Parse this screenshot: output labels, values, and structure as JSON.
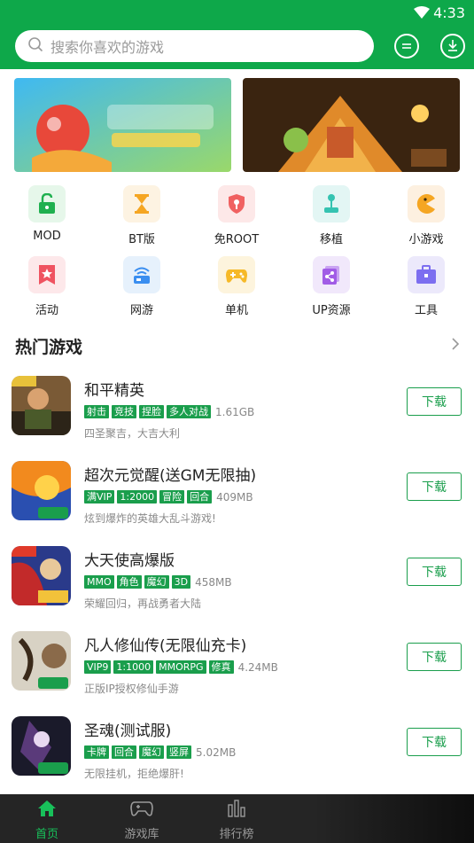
{
  "status": {
    "time": "4:33"
  },
  "search": {
    "placeholder": "搜索你喜欢的游戏"
  },
  "banners": [
    {
      "name": "banner-bouncing-ball-game"
    },
    {
      "name": "banner-sandbox-world-game"
    }
  ],
  "categories_row1": [
    {
      "label": "MOD",
      "icon": "lock-icon",
      "bg": "#e6f7ea",
      "color": "#1fb04f"
    },
    {
      "label": "BT版",
      "icon": "hourglass-icon",
      "bg": "#fdf3e2",
      "color": "#f5a623"
    },
    {
      "label": "免ROOT",
      "icon": "shield-icon",
      "bg": "#fde8e8",
      "color": "#f06161"
    },
    {
      "label": "移植",
      "icon": "joystick-icon",
      "bg": "#e3f6f4",
      "color": "#35c3b1"
    },
    {
      "label": "小游戏",
      "icon": "pacman-icon",
      "bg": "#fdf0e0",
      "color": "#f5a623"
    }
  ],
  "categories_row2": [
    {
      "label": "活动",
      "icon": "star-flag-icon",
      "bg": "#fde8ea",
      "color": "#ef5361"
    },
    {
      "label": "网游",
      "icon": "network-icon",
      "bg": "#e6f1fc",
      "color": "#3a8ef0"
    },
    {
      "label": "单机",
      "icon": "gamepad-icon",
      "bg": "#fdf4dd",
      "color": "#f6b928"
    },
    {
      "label": "UP资源",
      "icon": "share-icon",
      "bg": "#f1e8fb",
      "color": "#a15ce6"
    },
    {
      "label": "工具",
      "icon": "toolbox-icon",
      "bg": "#ece9fb",
      "color": "#7c6ef0"
    }
  ],
  "section": {
    "title": "热门游戏"
  },
  "games": [
    {
      "name": "和平精英",
      "tags": [
        "射击",
        "竞技",
        "捏脸",
        "多人对战"
      ],
      "size": "1.61GB",
      "desc": "四圣聚吉，大吉大利",
      "button": "下载",
      "thumb_a": "#7a5a36",
      "thumb_b": "#2c2418"
    },
    {
      "name": "超次元觉醒(送GM无限抽)",
      "tags": [
        "满VIP",
        "1:2000",
        "冒险",
        "回合"
      ],
      "size": "409MB",
      "desc": "炫到爆炸的英雄大乱斗游戏!",
      "button": "下载",
      "thumb_a": "#f28a1e",
      "thumb_b": "#2a4fb0"
    },
    {
      "name": "大天使高爆版",
      "tags": [
        "MMO",
        "角色",
        "魔幻",
        "3D"
      ],
      "size": "458MB",
      "desc": "荣耀回归，再战勇者大陆",
      "button": "下载",
      "thumb_a": "#c22a2a",
      "thumb_b": "#2a3a8a"
    },
    {
      "name": "凡人修仙传(无限仙充卡)",
      "tags": [
        "VIP9",
        "1:1000",
        "MMORPG",
        "修真"
      ],
      "size": "4.24MB",
      "desc": "正版IP授权修仙手游",
      "button": "下载",
      "thumb_a": "#d8d2c4",
      "thumb_b": "#8a6a4a"
    },
    {
      "name": "圣魂(测试服)",
      "tags": [
        "卡牌",
        "回合",
        "魔幻",
        "竖屏"
      ],
      "size": "5.02MB",
      "desc": "无限挂机，拒绝爆肝!",
      "button": "下载",
      "thumb_a": "#5a3a7a",
      "thumb_b": "#1a1a2a"
    }
  ],
  "thumb_badges": [
    "四圣聚吉",
    "7723",
    "连击技",
    "7723",
    "7723"
  ],
  "bottom_nav": [
    {
      "label": "首页",
      "active": true
    },
    {
      "label": "游戏库",
      "active": false
    },
    {
      "label": "排行榜",
      "active": false
    }
  ],
  "colors": {
    "brand_green": "#0ea84a",
    "tag_green": "#1a9e4c",
    "nav_bg": "#252525"
  }
}
